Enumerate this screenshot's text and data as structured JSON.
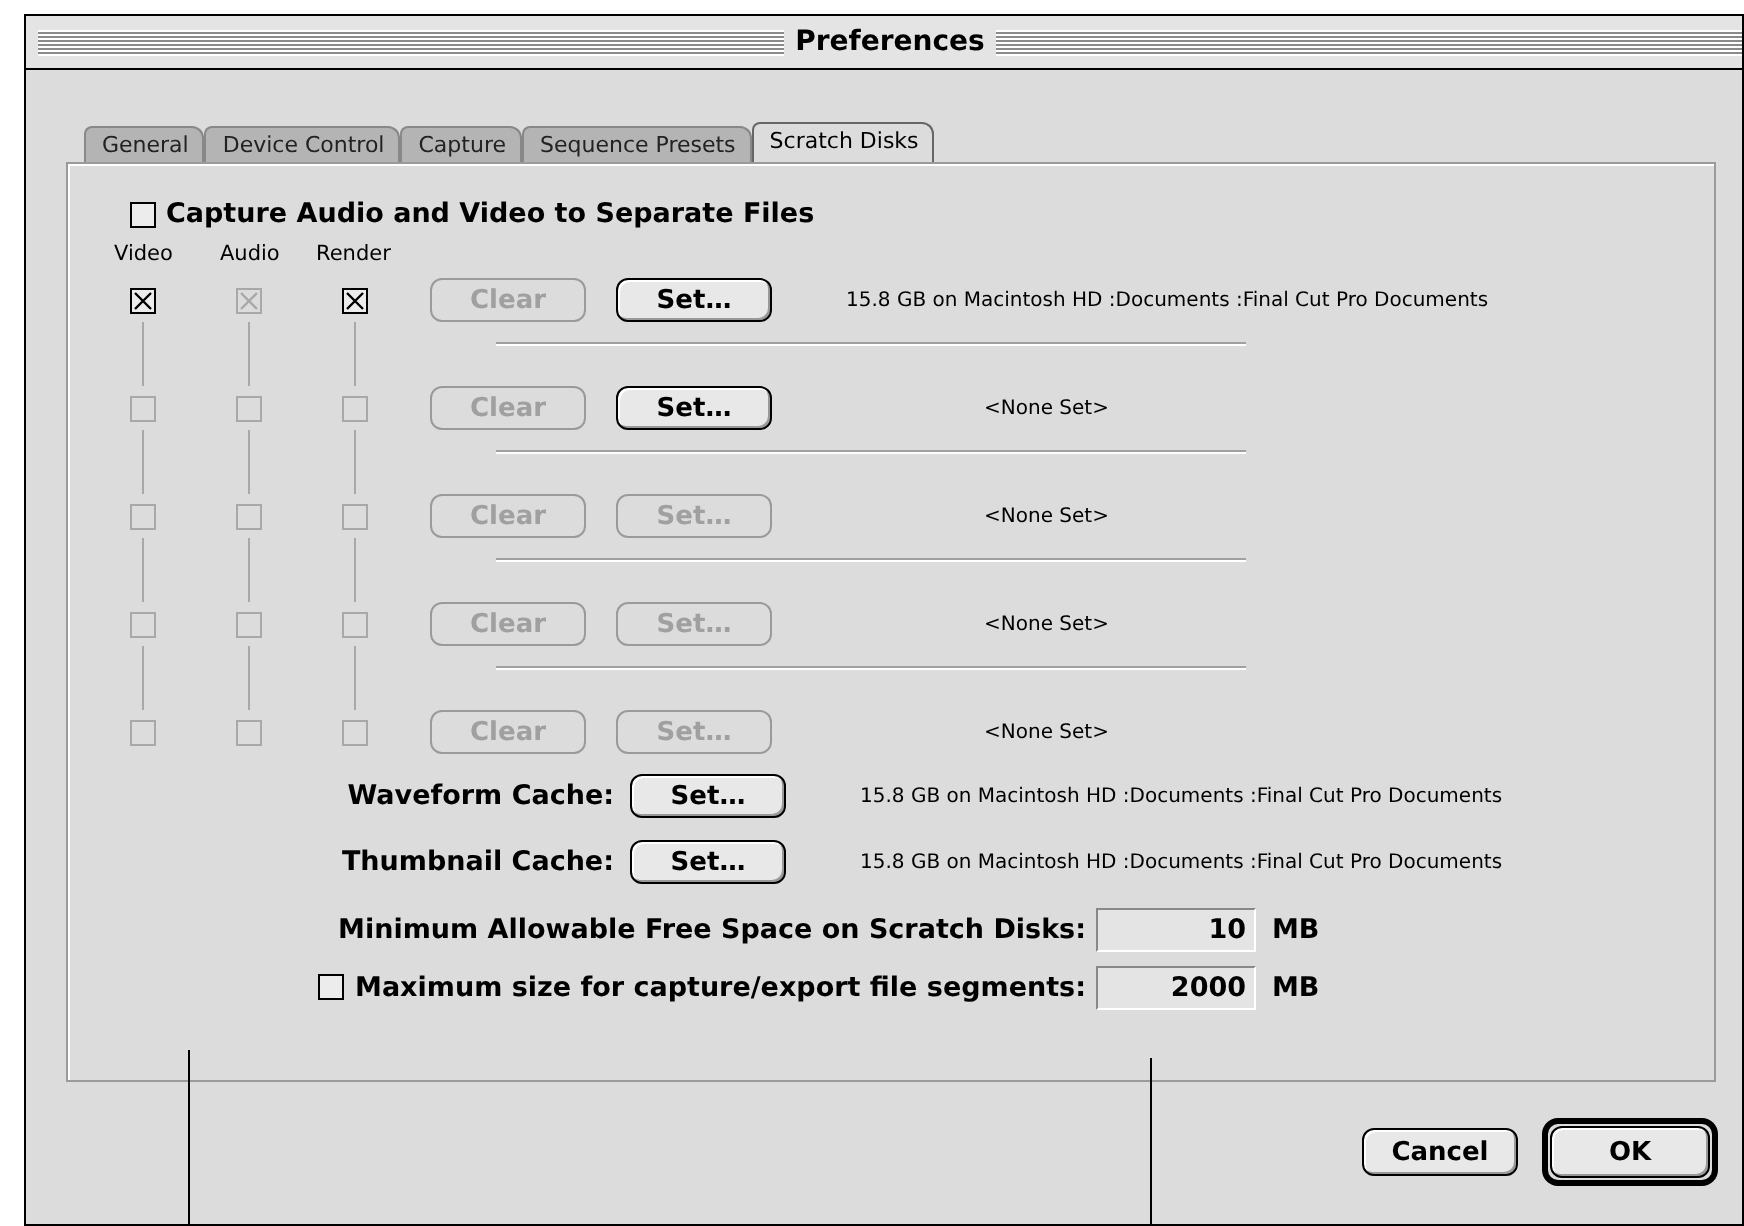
{
  "window": {
    "title": "Preferences"
  },
  "tabs": [
    {
      "label": "General",
      "selected": false
    },
    {
      "label": "Device Control",
      "selected": false
    },
    {
      "label": "Capture",
      "selected": false
    },
    {
      "label": "Sequence Presets",
      "selected": false
    },
    {
      "label": "Scratch Disks",
      "selected": true
    }
  ],
  "separate_files": {
    "label": "Capture Audio and Video to Separate Files",
    "checked": false
  },
  "columns": [
    "Video",
    "Audio",
    "Render"
  ],
  "disks": [
    {
      "video": {
        "checked": true,
        "disabled": false
      },
      "audio": {
        "checked": true,
        "disabled": true
      },
      "render": {
        "checked": true,
        "disabled": false
      },
      "clear": {
        "label": "Clear",
        "disabled": true
      },
      "set": {
        "label": "Set…",
        "disabled": false
      },
      "location": "15.8 GB on  Macintosh HD :Documents :Final Cut Pro Documents"
    },
    {
      "video": {
        "checked": false,
        "disabled": true
      },
      "audio": {
        "checked": false,
        "disabled": true
      },
      "render": {
        "checked": false,
        "disabled": true
      },
      "clear": {
        "label": "Clear",
        "disabled": true
      },
      "set": {
        "label": "Set…",
        "disabled": false
      },
      "location": "<None Set>"
    },
    {
      "video": {
        "checked": false,
        "disabled": true
      },
      "audio": {
        "checked": false,
        "disabled": true
      },
      "render": {
        "checked": false,
        "disabled": true
      },
      "clear": {
        "label": "Clear",
        "disabled": true
      },
      "set": {
        "label": "Set…",
        "disabled": true
      },
      "location": "<None Set>"
    },
    {
      "video": {
        "checked": false,
        "disabled": true
      },
      "audio": {
        "checked": false,
        "disabled": true
      },
      "render": {
        "checked": false,
        "disabled": true
      },
      "clear": {
        "label": "Clear",
        "disabled": true
      },
      "set": {
        "label": "Set…",
        "disabled": true
      },
      "location": "<None Set>"
    },
    {
      "video": {
        "checked": false,
        "disabled": true
      },
      "audio": {
        "checked": false,
        "disabled": true
      },
      "render": {
        "checked": false,
        "disabled": true
      },
      "clear": {
        "label": "Clear",
        "disabled": true
      },
      "set": {
        "label": "Set…",
        "disabled": true
      },
      "location": "<None Set>"
    }
  ],
  "caches": [
    {
      "label": "Waveform Cache:",
      "button": "Set…",
      "location": "15.8 GB on  Macintosh HD :Documents :Final Cut Pro Documents"
    },
    {
      "label": "Thumbnail Cache:",
      "button": "Set…",
      "location": "15.8 GB on  Macintosh HD :Documents :Final Cut Pro Documents"
    }
  ],
  "min_free": {
    "label": "Minimum Allowable Free Space on Scratch Disks:",
    "value": "10",
    "unit": "MB"
  },
  "max_segment": {
    "label": "Maximum size for capture/export file segments:",
    "checked": false,
    "value": "2000",
    "unit": "MB"
  },
  "buttons": [
    {
      "label": "Cancel",
      "default": false
    },
    {
      "label": "OK",
      "default": true
    }
  ]
}
